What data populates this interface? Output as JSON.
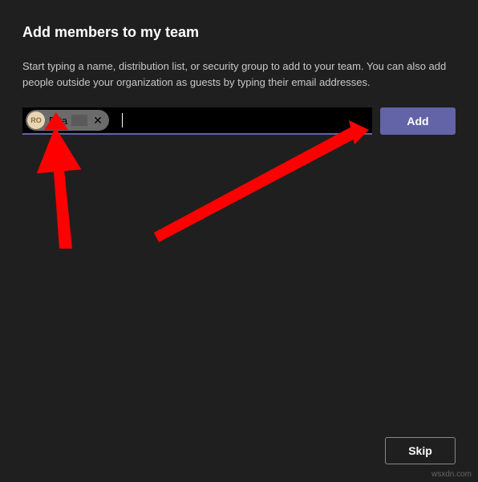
{
  "dialog": {
    "title": "Add members to my team",
    "description": "Start typing a name, distribution list, or security group to add to your team. You can also add people outside your organization as guests by typing their email addresses."
  },
  "input": {
    "chip": {
      "initials": "RO",
      "name": "Rita"
    },
    "value": ""
  },
  "buttons": {
    "add": "Add",
    "skip": "Skip"
  },
  "watermark": "wsxdn.com"
}
